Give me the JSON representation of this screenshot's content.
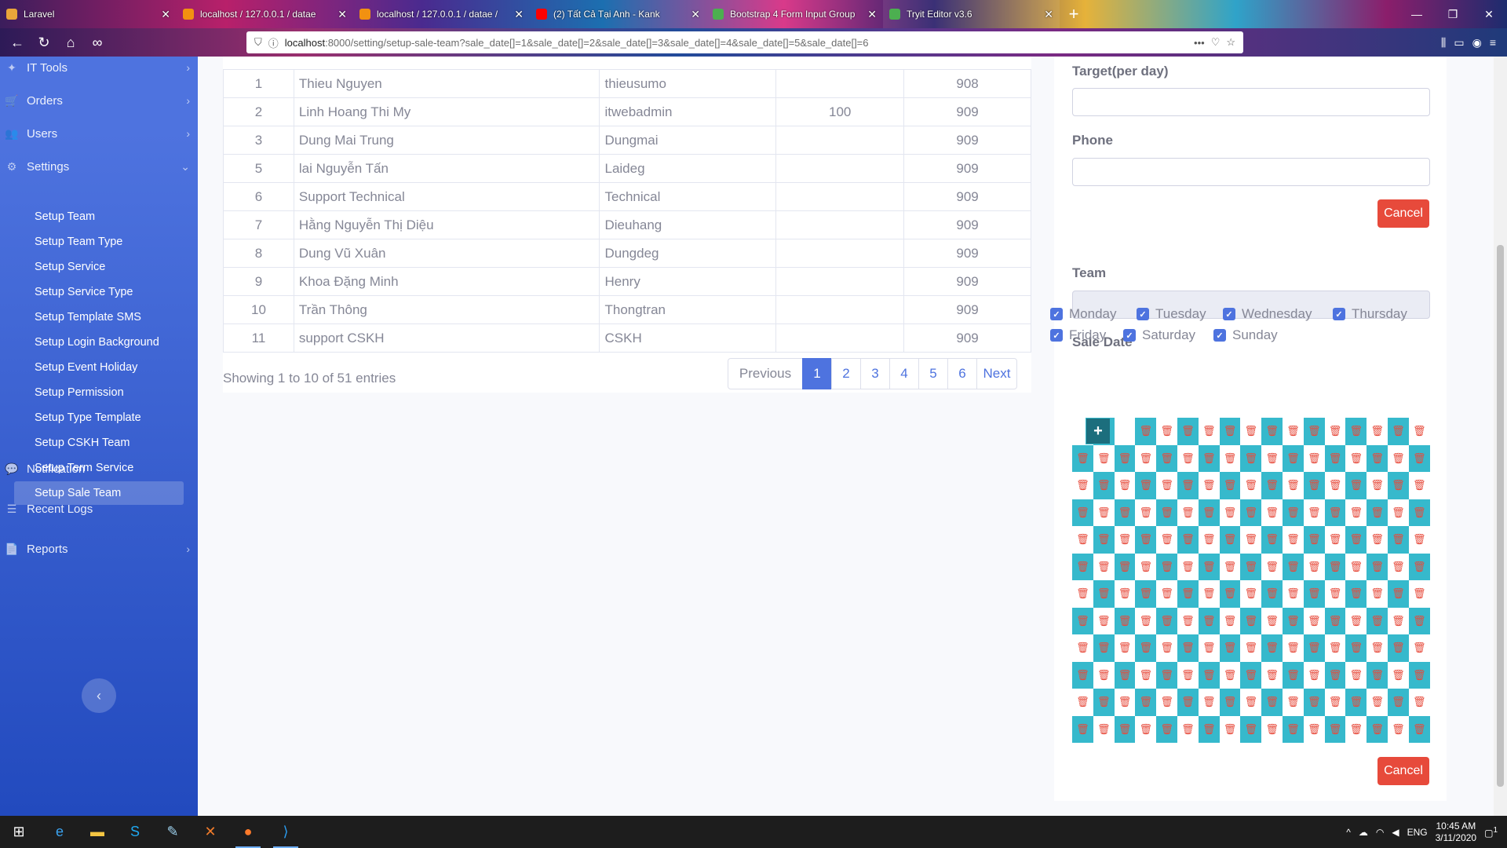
{
  "browser": {
    "tabs": [
      {
        "label": "Laravel",
        "color": "#e9a53a"
      },
      {
        "label": "localhost / 127.0.0.1 / datae",
        "color": "#f29111"
      },
      {
        "label": "localhost / 127.0.0.1 / datae /",
        "color": "#f29111"
      },
      {
        "label": "(2) Tất Cả Tại Anh - Kank",
        "color": "#ff0000"
      },
      {
        "label": "Bootstrap 4 Form Input Group",
        "color": "#4caf50"
      },
      {
        "label": "Tryit Editor v3.6",
        "color": "#4caf50"
      }
    ],
    "url_host": "localhost",
    "url_rest": ":8000/setting/setup-sale-team?sale_date[]=1&sale_date[]=2&sale_date[]=3&sale_date[]=4&sale_date[]=5&sale_date[]=6"
  },
  "sidebar": {
    "items": [
      {
        "label": "IT Tools",
        "icon": "tools-icon",
        "chevron": "›"
      },
      {
        "label": "Orders",
        "icon": "cart-icon",
        "chevron": "›"
      },
      {
        "label": "Users",
        "icon": "users-icon",
        "chevron": "›"
      },
      {
        "label": "Settings",
        "icon": "gear-icon",
        "chevron": "⌄"
      }
    ],
    "settings_sub": [
      {
        "label": "Setup Team"
      },
      {
        "label": "Setup Team Type"
      },
      {
        "label": "Setup Service"
      },
      {
        "label": "Setup Service Type"
      },
      {
        "label": "Setup Template SMS"
      },
      {
        "label": "Setup Login Background"
      },
      {
        "label": "Setup Event Holiday"
      },
      {
        "label": "Setup Permission"
      },
      {
        "label": "Setup Type Template"
      },
      {
        "label": "Setup CSKH Team"
      },
      {
        "label": "Setup Term Service"
      },
      {
        "label": "Setup Sale Team"
      }
    ],
    "active_sub": "Setup Sale Team",
    "bottom_items": [
      {
        "label": "Notification",
        "icon": "bell-icon",
        "chevron": ""
      },
      {
        "label": "Recent Logs",
        "icon": "list-icon",
        "chevron": ""
      },
      {
        "label": "Reports",
        "icon": "file-icon",
        "chevron": "›"
      }
    ]
  },
  "table": {
    "rows": [
      {
        "no": "1",
        "name": "Thieu Nguyen",
        "username": "thieusumo",
        "target": "",
        "ext": "908"
      },
      {
        "no": "2",
        "name": "Linh Hoang Thi My",
        "username": "itwebadmin",
        "target": "100",
        "ext": "909"
      },
      {
        "no": "3",
        "name": "Dung Mai Trung",
        "username": "Dungmai",
        "target": "",
        "ext": "909"
      },
      {
        "no": "5",
        "name": "lai Nguyễn Tấn",
        "username": "Laideg",
        "target": "",
        "ext": "909"
      },
      {
        "no": "6",
        "name": "Support Technical",
        "username": "Technical",
        "target": "",
        "ext": "909"
      },
      {
        "no": "7",
        "name": "Hằng Nguyễn Thị Diệu",
        "username": "Dieuhang",
        "target": "",
        "ext": "909"
      },
      {
        "no": "8",
        "name": "Dung Vũ Xuân",
        "username": "Dungdeg",
        "target": "",
        "ext": "909"
      },
      {
        "no": "9",
        "name": "Khoa Đặng Minh",
        "username": "Henry",
        "target": "",
        "ext": "909"
      },
      {
        "no": "10",
        "name": "Trần Thông",
        "username": "Thongtran",
        "target": "",
        "ext": "909"
      },
      {
        "no": "11",
        "name": "support CSKH",
        "username": "CSKH",
        "target": "",
        "ext": "909"
      }
    ],
    "info": "Showing 1 to 10 of 51 entries",
    "pagination": {
      "prev": "Previous",
      "pages": [
        "1",
        "2",
        "3",
        "4",
        "5",
        "6"
      ],
      "active": "1",
      "next": "Next"
    }
  },
  "form": {
    "target_label": "Target(per day)",
    "phone_label": "Phone",
    "cancel_label": "Cancel",
    "team_label": "Team",
    "sale_date_label": "Sale Date",
    "days": [
      {
        "label": "Monday",
        "checked": true
      },
      {
        "label": "Tuesday",
        "checked": true
      },
      {
        "label": "Wednesday",
        "checked": true
      },
      {
        "label": "Thursday",
        "checked": true
      },
      {
        "label": "Friday",
        "checked": true
      },
      {
        "label": "Saturday",
        "checked": true
      },
      {
        "label": "Sunday",
        "checked": true
      }
    ],
    "grid_add_symbol": "+",
    "cancel_label_2": "Cancel"
  },
  "taskbar": {
    "lang": "ENG",
    "time": "10:45 AM",
    "date": "3/11/2020",
    "notification_count": "1"
  }
}
